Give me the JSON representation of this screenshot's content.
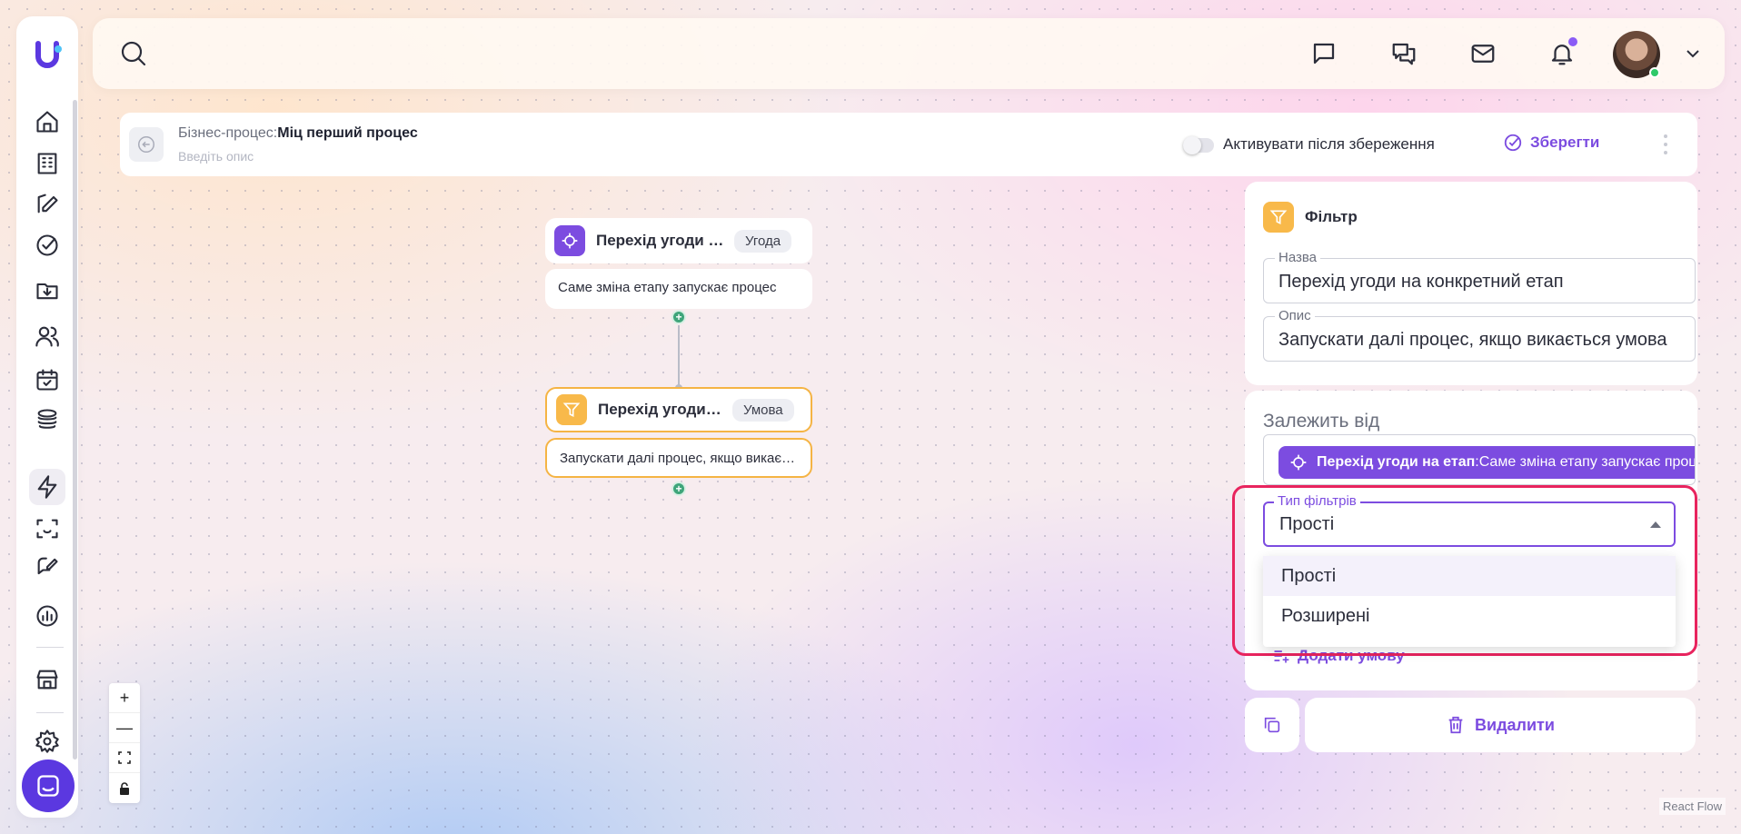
{
  "process": {
    "label": "Бізнес-процес:",
    "name": "Міц перший процес",
    "description_placeholder": "Введіть опис",
    "activate_label": "Активувати після збереження",
    "save_label": "Зберегти"
  },
  "nodes": [
    {
      "title": "Перехід угоди на конкретний етап",
      "tag": "Угода",
      "body": "Саме зміна етапу запускає процес"
    },
    {
      "title": "Перехід угоди на конкретний етап",
      "tag": "Умова",
      "body": "Запускати далі процес, якщо викається умова"
    }
  ],
  "panel": {
    "filter_title": "Фільтр",
    "name_label": "Назва",
    "name_value": "Перехід угоди на конкретний етап",
    "desc_label": "Опис",
    "desc_value": "Запускати далі процес, якщо викається умова",
    "depends_label": "Залежить від",
    "depends_chip_bold": "Перехід угоди на етап",
    "depends_chip_text": ":Саме зміна етапу запускає процес",
    "filter_type_label": "Тип фільтрів",
    "filter_type_value": "Прості",
    "filter_type_options": [
      "Прості",
      "Розширені"
    ],
    "add_condition_label": "Додати умову",
    "delete_label": "Видалити"
  },
  "attribution": "React Flow",
  "colors": {
    "accent": "#7c4ce0",
    "highlight": "#e8245e",
    "filter": "#f8b94a",
    "trigger": "#7c4ce0"
  }
}
